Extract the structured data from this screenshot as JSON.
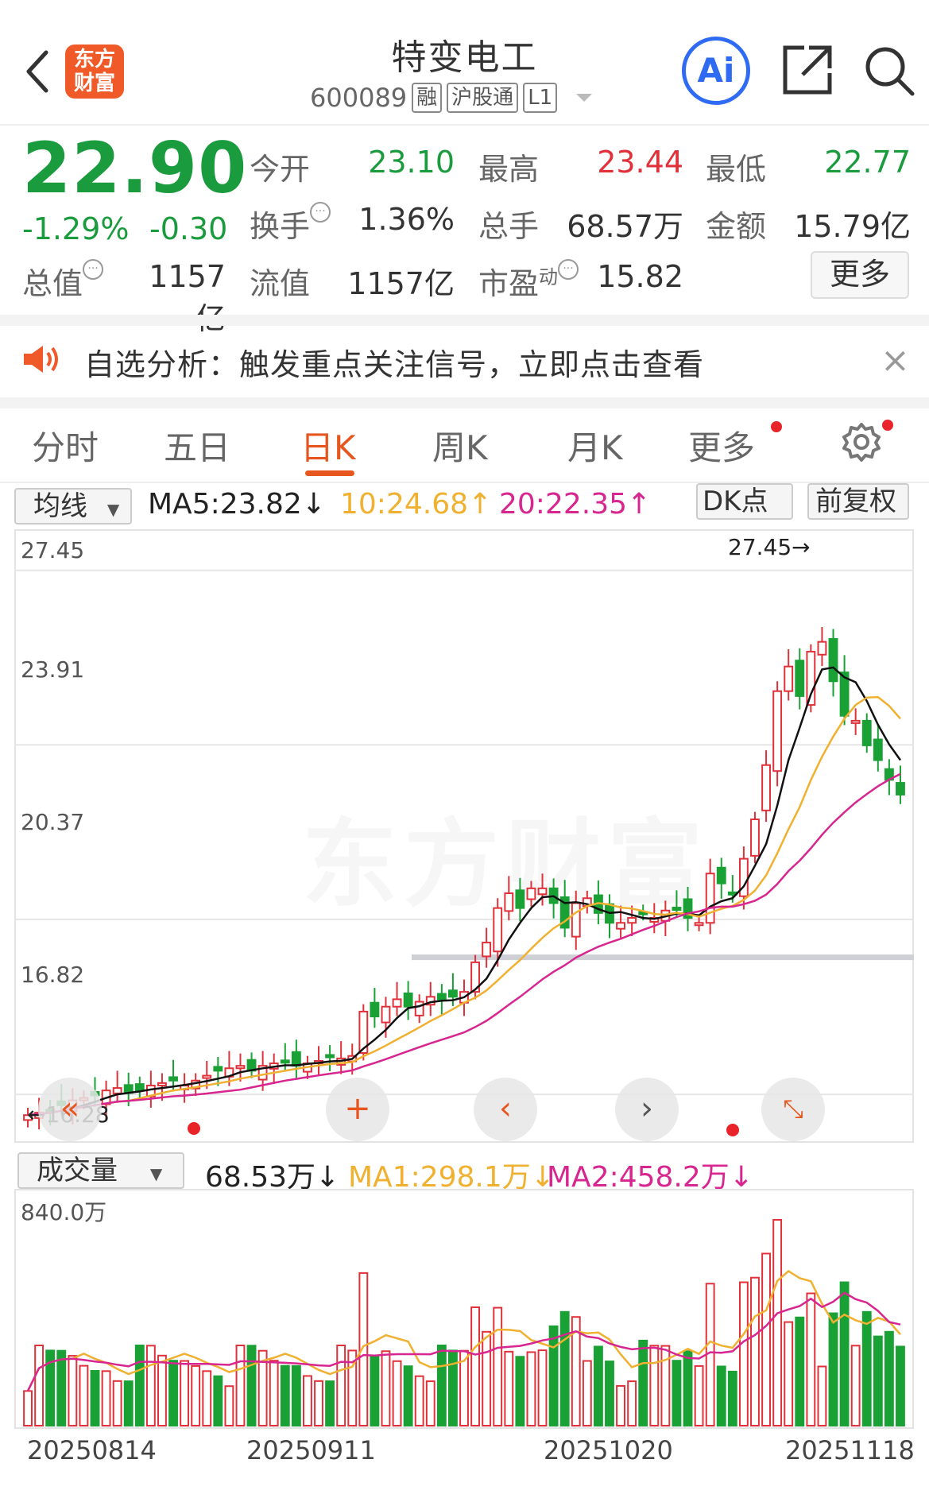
{
  "header": {
    "title": "特变电工",
    "code": "600089",
    "tags": [
      "融",
      "沪股通",
      "L1"
    ],
    "logo_text_1": "东方",
    "logo_text_2": "财富",
    "ai_label": "Ai"
  },
  "quote": {
    "price": "22.90",
    "change_pct": "-1.29%",
    "change_amt": "-0.30",
    "open_label": "今开",
    "open": "23.10",
    "high_label": "最高",
    "high": "23.44",
    "low_label": "最低",
    "low": "22.77",
    "turnover_label": "换手",
    "turnover": "1.36%",
    "volume_label": "总手",
    "volume": "68.57万",
    "amount_label": "金额",
    "amount": "15.79亿",
    "total_value_label": "总值",
    "total_value": "1157亿",
    "float_value_label": "流值",
    "float_value": "1157亿",
    "pe_label": "市盈",
    "pe_sup": "动",
    "pe": "15.82",
    "more_label": "更多"
  },
  "notice": {
    "text": "自选分析：触发重点关注信号，立即点击查看",
    "close": "×"
  },
  "tabs": [
    {
      "label": "分时"
    },
    {
      "label": "五日"
    },
    {
      "label": "日K"
    },
    {
      "label": "周K"
    },
    {
      "label": "月K"
    },
    {
      "label": "更多"
    }
  ],
  "indicators": {
    "selector": "均线",
    "ma5": "MA5:23.82↓",
    "ma10": "10:24.68↑",
    "ma20": "20:22.35↑",
    "dk_label": "DK点",
    "fq_label": "前复权"
  },
  "kline": {
    "y_labels": [
      "27.45",
      "23.91",
      "20.37",
      "16.82"
    ],
    "max_marker": "27.45→",
    "min_marker": "←16.28"
  },
  "volume": {
    "selector": "成交量",
    "value": "68.53万↓",
    "ma1": "MA1:298.1万↓",
    "ma2": "MA2:458.2万↓",
    "y_label": "840.0万"
  },
  "x_labels": [
    "20250814",
    "20250911",
    "20251020",
    "20251118"
  ],
  "colors": {
    "up": "#e0313a",
    "down": "#1aa135",
    "ma5": "#111111",
    "ma10": "#f0b030",
    "ma20": "#d7268f",
    "accent": "#e8561f"
  },
  "chart_data": {
    "type": "candlestick",
    "closes": [
      16.4,
      16.45,
      16.5,
      16.6,
      16.7,
      16.75,
      16.8,
      16.9,
      16.95,
      16.85,
      16.9,
      17.0,
      17.05,
      17.1,
      17.0,
      17.1,
      17.2,
      17.3,
      17.35,
      17.4,
      17.3,
      17.4,
      17.45,
      17.5,
      17.4,
      17.45,
      17.5,
      17.6,
      17.55,
      17.6,
      18.5,
      18.4,
      18.6,
      18.75,
      18.6,
      18.7,
      18.8,
      18.75,
      18.8,
      18.9,
      19.5,
      19.9,
      20.6,
      20.9,
      20.6,
      21.0,
      21.0,
      20.7,
      20.2,
      20.7,
      20.8,
      20.5,
      20.3,
      20.3,
      20.4,
      20.5,
      20.4,
      20.55,
      20.6,
      20.4,
      20.3,
      21.3,
      21.1,
      20.9,
      21.6,
      22.4,
      23.5,
      25.0,
      25.5,
      24.9,
      25.8,
      26.0,
      25.2,
      24.5,
      24.4,
      23.9,
      23.6,
      23.2,
      22.9
    ],
    "ma5_last": 23.82,
    "ma10_last": 24.68,
    "ma20_last": 22.35,
    "ylim": [
      16.0,
      27.8
    ]
  }
}
